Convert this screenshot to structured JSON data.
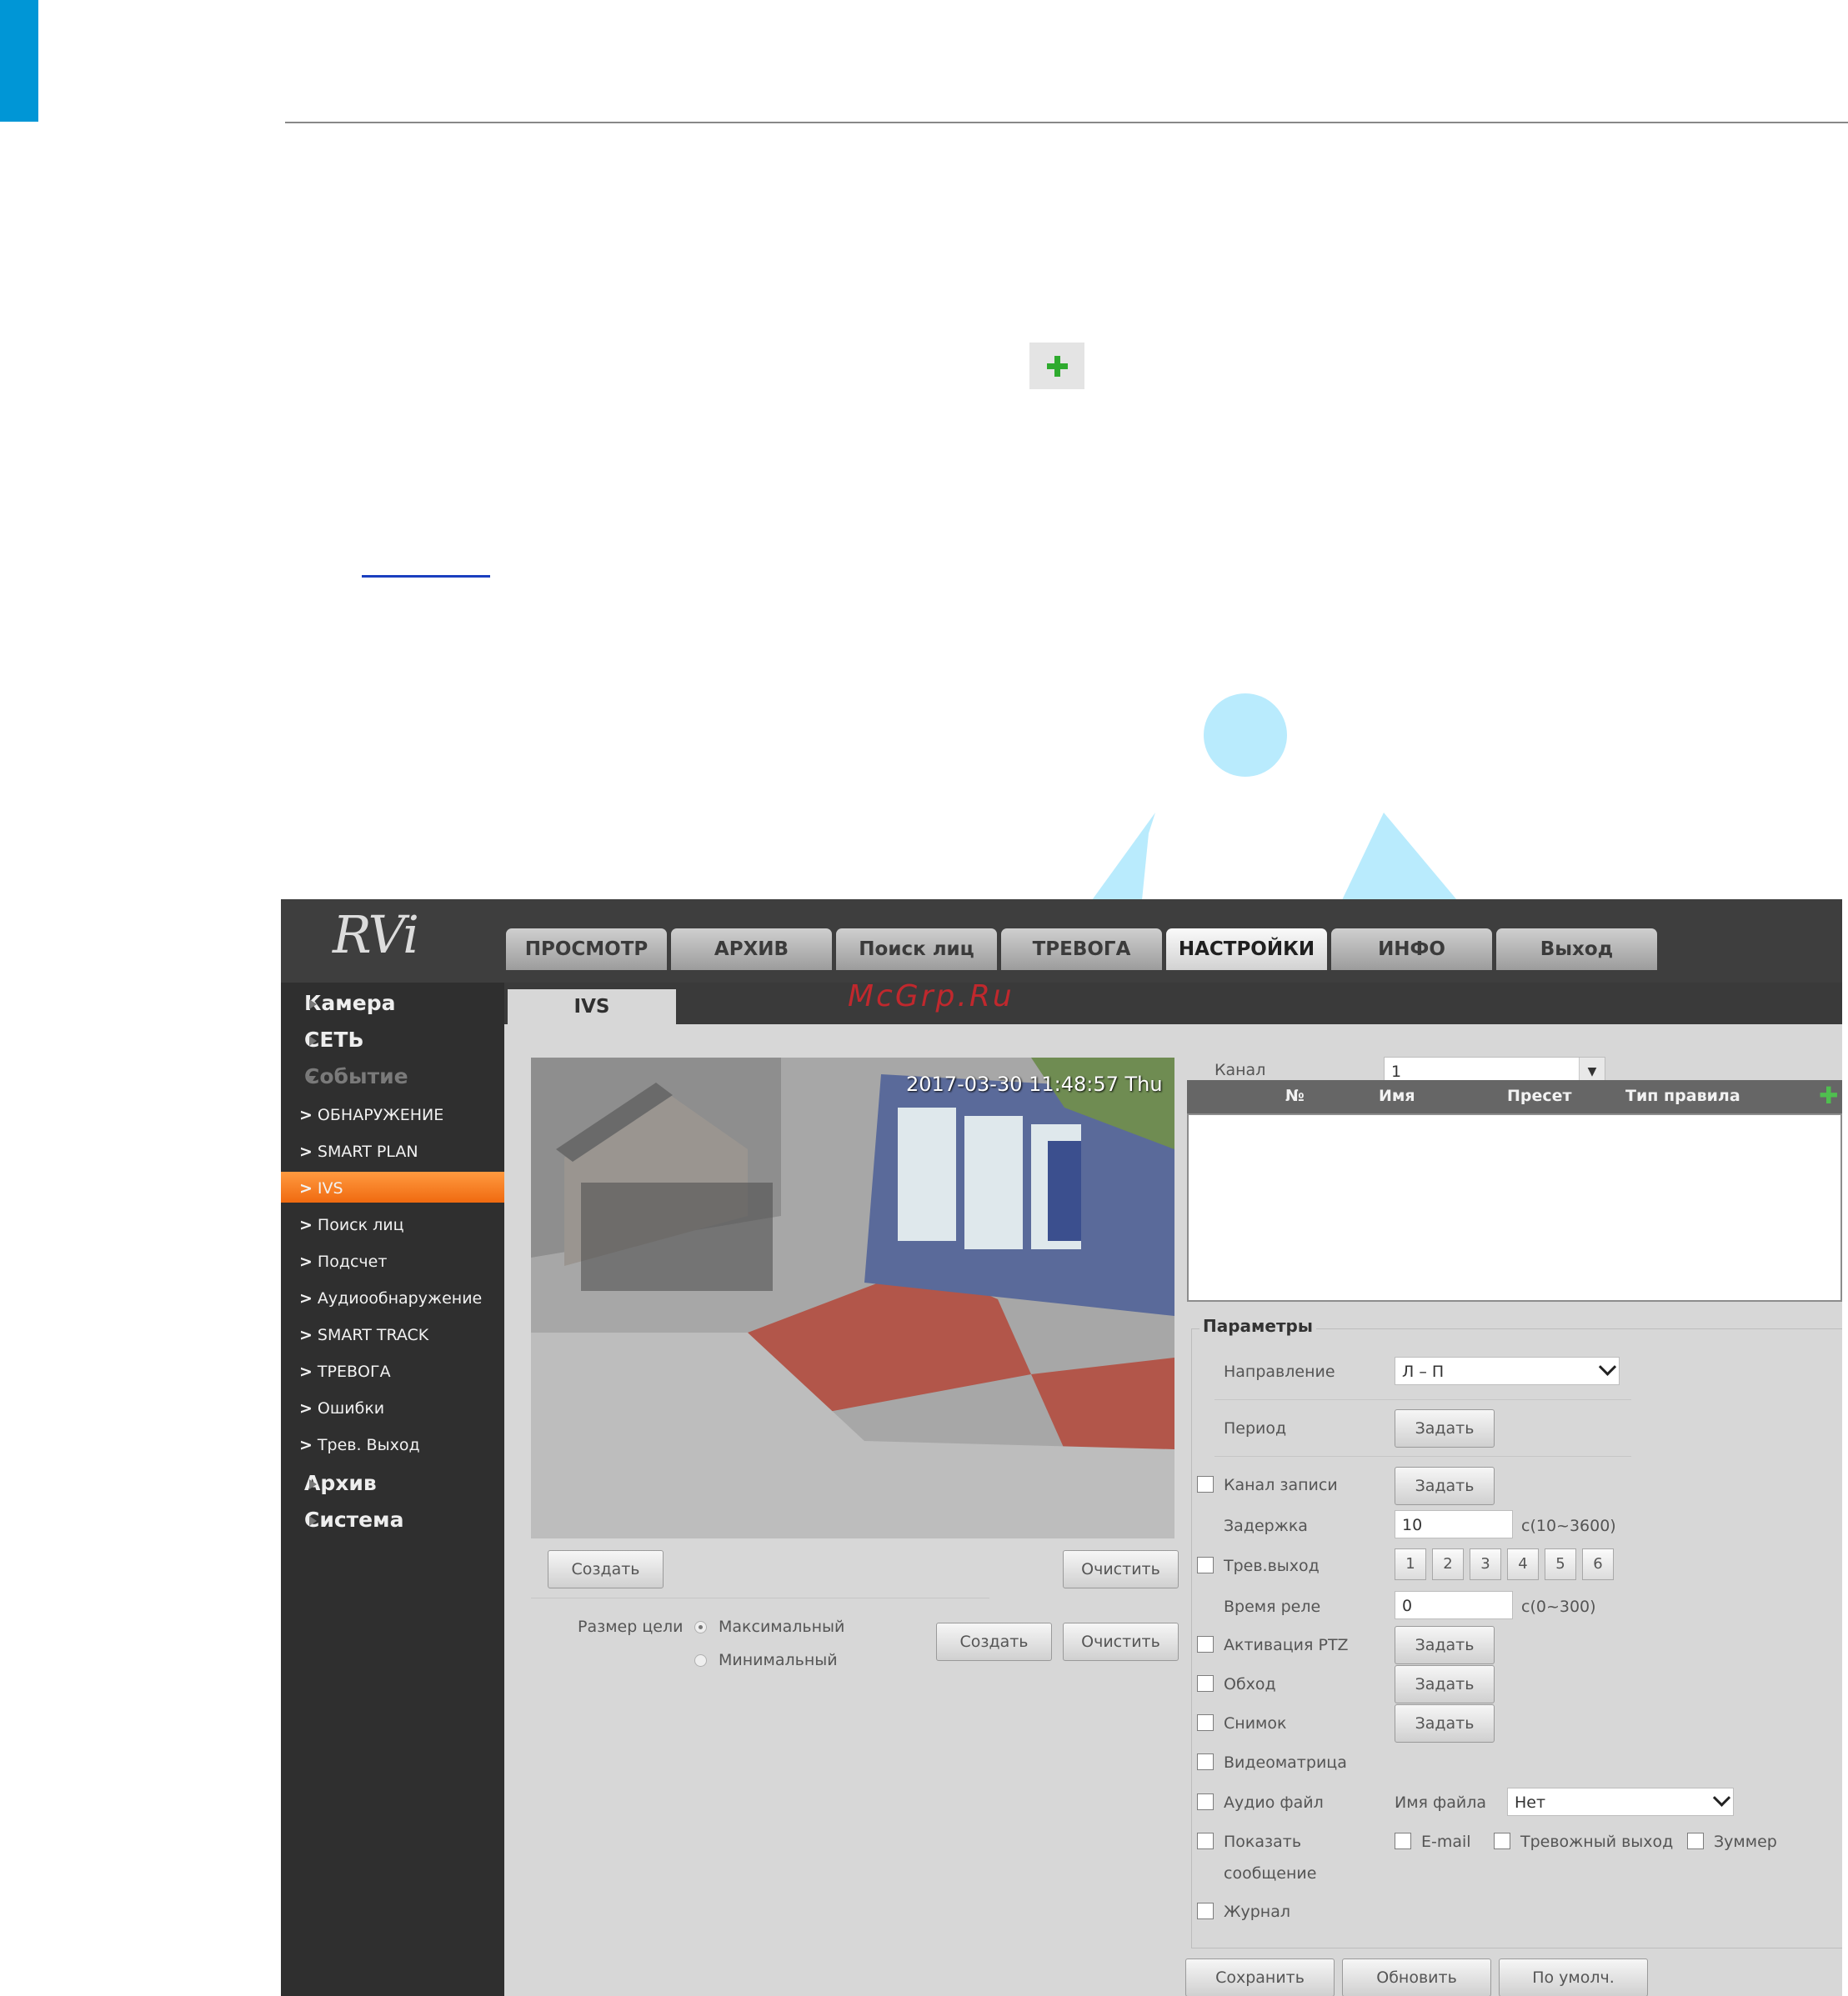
{
  "document": {
    "colors": {
      "blue_tab": "#0096d6",
      "rule": "#888888",
      "deco": "#b9ebfd",
      "plus": "#2eaa2e"
    }
  },
  "dvr": {
    "logo": "RVi",
    "watermark": "McGrp.Ru",
    "top_nav": [
      {
        "label": "ПРОСМОТР",
        "active": false
      },
      {
        "label": "АРХИВ",
        "active": false
      },
      {
        "label": "Поиск лиц",
        "active": false
      },
      {
        "label": "ТРЕВОГА",
        "active": false
      },
      {
        "label": "НАСТРОЙКИ",
        "active": true
      },
      {
        "label": "ИНФО",
        "active": false
      },
      {
        "label": "Выход",
        "active": false
      }
    ],
    "sidebar": {
      "camera": "Камера",
      "network": "СЕТЬ",
      "event": "Событие",
      "event_items": [
        "ОБНАРУЖЕНИЕ",
        "SMART PLAN",
        "IVS",
        "Поиск лиц",
        "Подсчет",
        "Аудиообнаружение",
        "SMART TRACK",
        "ТРЕВОГА",
        "Ошибки",
        "Трев. Выход"
      ],
      "active_item": "IVS",
      "archive": "Архив",
      "system": "Система"
    },
    "tab": "IVS",
    "video": {
      "timestamp": "2017-03-30 11:48:57 Thu"
    },
    "left_panel": {
      "create_label": "Создать",
      "clear_label": "Очистить",
      "target_size_label": "Размер цели",
      "opt_max": "Максимальный",
      "opt_min": "Минимальный",
      "create2_label": "Создать",
      "clear2_label": "Очистить"
    },
    "channel": {
      "label": "Канал",
      "value": "1"
    },
    "rules_table": {
      "columns": [
        "№",
        "Имя",
        "Пресет",
        "Тип правила"
      ]
    },
    "params": {
      "legend": "Параметры",
      "direction_label": "Направление",
      "direction_value": "Л – П",
      "period_label": "Период",
      "set_label": "Задать",
      "record_channel_label": "Канал записи",
      "delay_label": "Задержка",
      "delay_value": "10",
      "delay_unit": "с(10~3600)",
      "alarm_out_label": "Трев.выход",
      "alarm_out_numbers": [
        "1",
        "2",
        "3",
        "4",
        "5",
        "6"
      ],
      "relay_time_label": "Время реле",
      "relay_time_value": "0",
      "relay_time_unit": "с(0~300)",
      "ptz_label": "Активация PTZ",
      "tour_label": "Обход",
      "snapshot_label": "Снимок",
      "matrix_label": "Видеоматрица",
      "audio_label": "Аудио файл",
      "file_name_label": "Имя файла",
      "file_name_value": "Нет",
      "show_message_label": "Показать",
      "show_message_label2": "сообщение",
      "email_label": "E-mail",
      "alarm_output_label": "Тревожный выход",
      "buzzer_label": "Зуммер",
      "log_label": "Журнал"
    },
    "bottom_buttons": {
      "save": "Сохранить",
      "refresh": "Обновить",
      "default": "По умолч."
    }
  }
}
